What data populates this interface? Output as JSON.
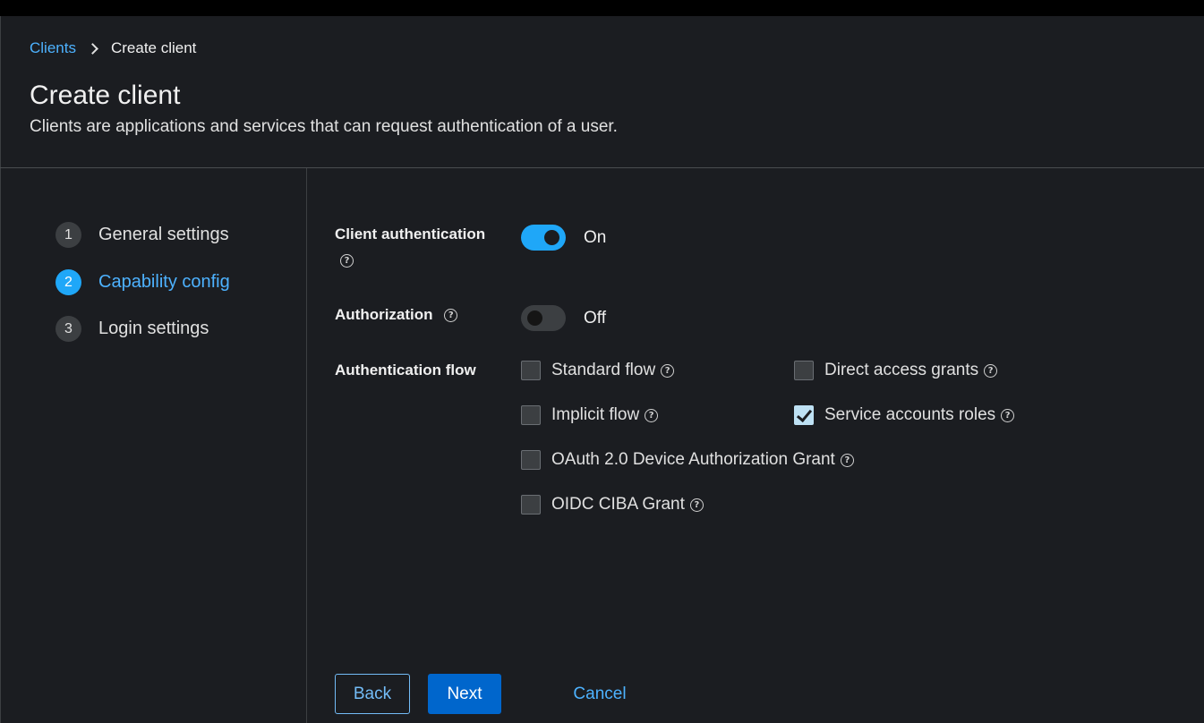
{
  "breadcrumb": {
    "parent": "Clients",
    "current": "Create client"
  },
  "header": {
    "title": "Create client",
    "description": "Clients are applications and services that can request authentication of a user."
  },
  "wizard": {
    "steps": [
      {
        "number": "1",
        "label": "General settings",
        "active": false
      },
      {
        "number": "2",
        "label": "Capability config",
        "active": true
      },
      {
        "number": "3",
        "label": "Login settings",
        "active": false
      }
    ]
  },
  "form": {
    "client_authentication": {
      "label": "Client authentication",
      "state": "On",
      "enabled": true
    },
    "authorization": {
      "label": "Authorization",
      "state": "Off",
      "enabled": false
    },
    "authentication_flow": {
      "label": "Authentication flow",
      "options": [
        {
          "label": "Standard flow",
          "checked": false
        },
        {
          "label": "Direct access grants",
          "checked": false
        },
        {
          "label": "Implicit flow",
          "checked": false
        },
        {
          "label": "Service accounts roles",
          "checked": true
        },
        {
          "label": "OAuth 2.0 Device Authorization Grant",
          "checked": false
        },
        {
          "label": "OIDC CIBA Grant",
          "checked": false
        }
      ]
    }
  },
  "actions": {
    "back": "Back",
    "next": "Next",
    "cancel": "Cancel"
  },
  "help_glyph": "?",
  "colors": {
    "background": "#1b1d21",
    "accent": "#1fa7f8",
    "link": "#4db2ff",
    "primary_button": "#0066cc"
  }
}
